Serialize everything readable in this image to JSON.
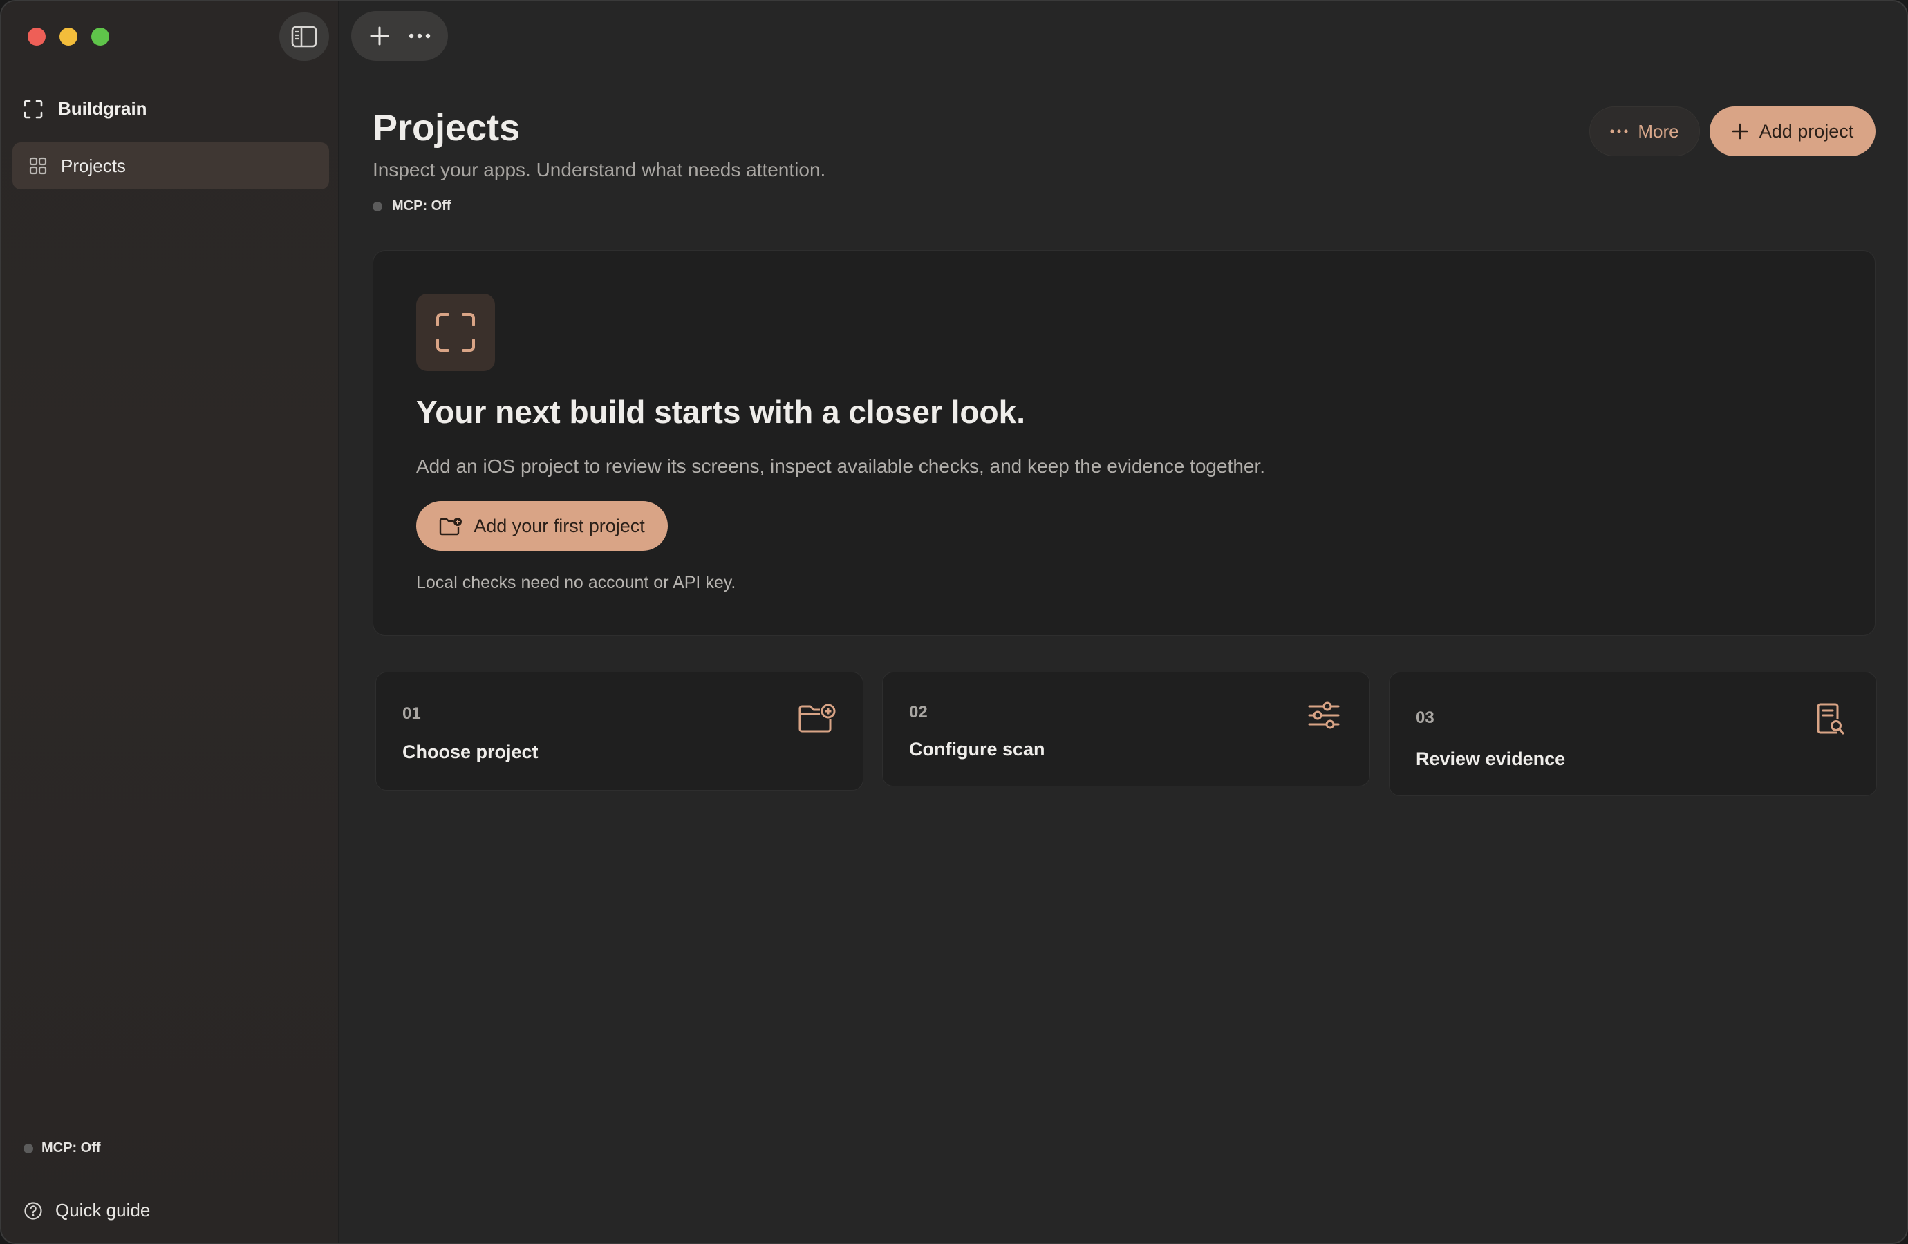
{
  "sidebar": {
    "brand": "Buildgrain",
    "nav_items": [
      {
        "label": "Projects",
        "icon": "grid-icon",
        "active": true
      }
    ],
    "status": "MCP: Off",
    "quick_guide": "Quick guide"
  },
  "toolbar": {
    "toggle_icon": "sidebar-toggle-icon",
    "new_icon": "plus-icon",
    "more_icon": "ellipsis-icon"
  },
  "header": {
    "title": "Projects",
    "subtitle": "Inspect your apps. Understand what needs attention.",
    "status": "MCP: Off",
    "more_label": "More",
    "add_label": "Add project"
  },
  "hero": {
    "title": "Your next build starts with a closer look.",
    "description": "Add an iOS project to review its screens, inspect available checks, and keep the evidence together.",
    "cta_label": "Add your first project",
    "note": "Local checks need no account or API key."
  },
  "steps": [
    {
      "number": "01",
      "title": "Choose project",
      "icon": "folder-add-icon"
    },
    {
      "number": "02",
      "title": "Configure scan",
      "icon": "sliders-icon"
    },
    {
      "number": "03",
      "title": "Review evidence",
      "icon": "document-search-icon"
    }
  ],
  "colors": {
    "accent": "#d9a486",
    "accent_text": "#d9a88b",
    "background": "#262626",
    "card": "#1f1f1f",
    "status_dot": "#5c5c5c"
  }
}
